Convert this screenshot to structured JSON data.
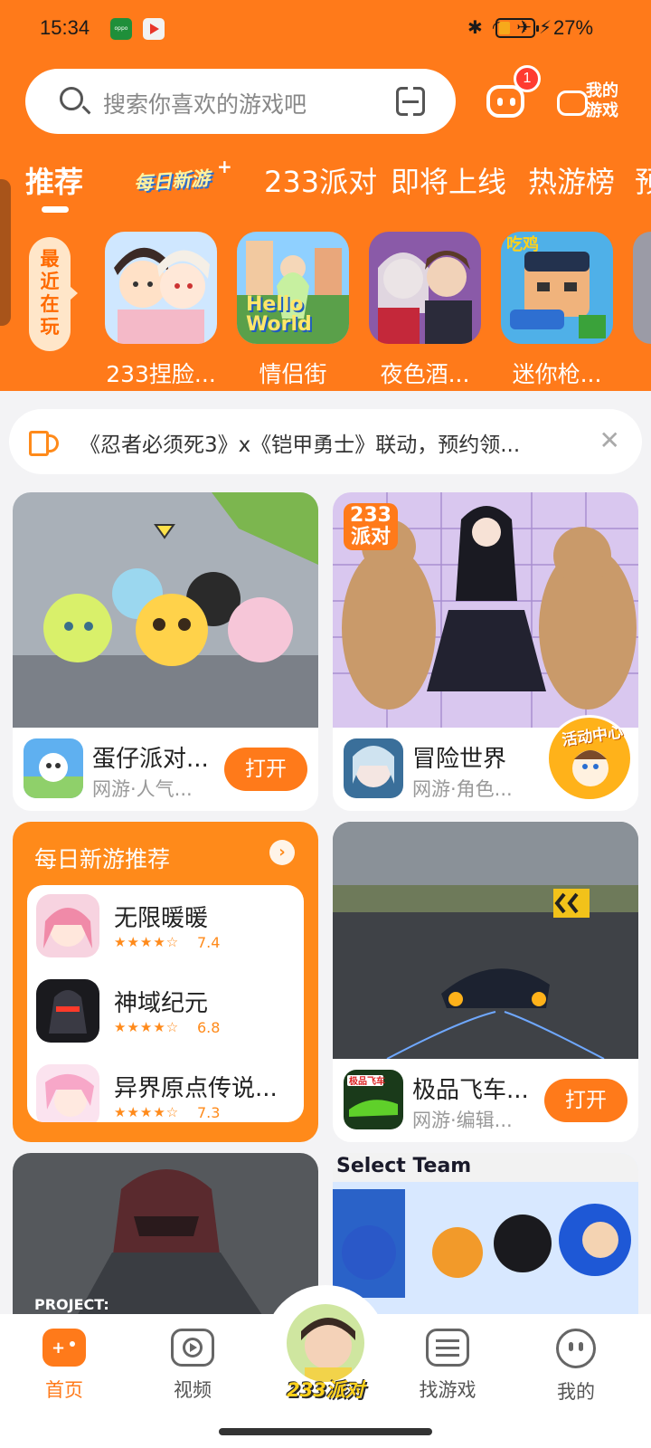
{
  "status_bar": {
    "time": "15:34",
    "battery_pct": "27%"
  },
  "search": {
    "placeholder": "搜索你喜欢的游戏吧"
  },
  "header": {
    "message_badge": "1",
    "my_games_label": "我的游戏"
  },
  "tabs": [
    {
      "label": "推荐",
      "active": true
    },
    {
      "label": "每日新游"
    },
    {
      "label": "233派对"
    },
    {
      "label": "即将上线"
    },
    {
      "label": "热游榜"
    },
    {
      "label": "预"
    }
  ],
  "recent": {
    "label": "最近在玩",
    "items": [
      {
        "name": "233捏脸..."
      },
      {
        "name": "情侣街",
        "thumb_text": "Hello World"
      },
      {
        "name": "夜色酒..."
      },
      {
        "name": "迷你枪..."
      }
    ]
  },
  "notice": {
    "text": "《忍者必须死3》x《铠甲勇士》联动，预约领..."
  },
  "cards": [
    {
      "title": "蛋仔派对...",
      "sub": "网游·人气...",
      "button": "打开"
    },
    {
      "title": "冒险世界",
      "sub": "网游·角色...",
      "badge_overlay": "233派对",
      "corner_badge": "活动中心"
    },
    {
      "title": "极品飞车...",
      "sub": "网游·编辑...",
      "button": "打开",
      "icon_text": "极品飞车"
    },
    {
      "img_text": "PROJECT:"
    },
    {
      "img_text": "Select Team"
    }
  ],
  "daily": {
    "title": "每日新游推荐",
    "items": [
      {
        "name": "无限暖暖",
        "rating": "7.4"
      },
      {
        "name": "神域纪元",
        "rating": "6.8"
      },
      {
        "name": "异界原点传说...",
        "rating": "7.3"
      }
    ]
  },
  "nav": [
    {
      "label": "首页",
      "active": true
    },
    {
      "label": "视频"
    },
    {
      "label": "233派对"
    },
    {
      "label": "找游戏"
    },
    {
      "label": "我的"
    }
  ],
  "colors": {
    "brand": "#ff7a1a",
    "background": "#f3f3f5"
  }
}
